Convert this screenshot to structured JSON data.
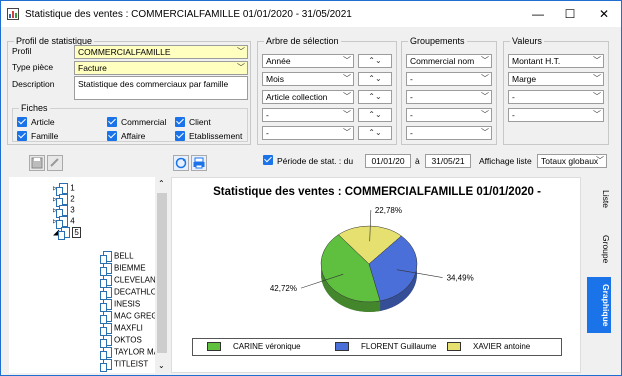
{
  "window": {
    "title": "Statistique des ventes : COMMERCIALFAMILLE 01/01/2020 - 31/05/2021",
    "minimize": "—",
    "maximize": "☐",
    "close": "✕"
  },
  "profil": {
    "group_title": "Profil de statistique",
    "profil_label": "Profil",
    "profil_value": "COMMERCIALFAMILLE",
    "type_label": "Type pièce",
    "type_value": "Facture",
    "desc_label": "Description",
    "desc_value": "Statistique des commerciaux par famille",
    "fiches_title": "Fiches",
    "fiches": [
      "Article",
      "Commercial",
      "Client",
      "Famille",
      "Affaire",
      "Etablissement"
    ]
  },
  "arbre": {
    "group_title": "Arbre de sélection",
    "rows": [
      "Année",
      "Mois",
      "Article collection",
      "-",
      "-"
    ]
  },
  "groupements": {
    "group_title": "Groupements",
    "rows": [
      "Commercial nom",
      "-",
      "-",
      "-",
      "-"
    ]
  },
  "valeurs": {
    "group_title": "Valeurs",
    "rows": [
      "Montant H.T.",
      "Marge",
      "-",
      "-"
    ]
  },
  "period": {
    "label": "Période de stat. : du",
    "from": "01/01/20",
    "to_label": "à",
    "to": "31/05/21",
    "affichage_label": "Affichage liste",
    "affichage_value": "Totaux globaux"
  },
  "tree": {
    "nodes": [
      "1",
      "2",
      "3",
      "4",
      "5"
    ],
    "children": [
      "BELL",
      "BIEMME",
      "CLEVELAND",
      "DECATHLON",
      "INESIS",
      "MAC GREGOR",
      "MAXFLI",
      "OKTOS",
      "TAYLOR MADE",
      "TITLEIST"
    ]
  },
  "chart_data": {
    "type": "pie",
    "title": "Statistique des ventes : COMMERCIALFAMILLE 01/01/2020 -",
    "categories": [
      "CARINE véronique",
      "FLORENT Guillaume",
      "XAVIER antoine"
    ],
    "values": [
      42.72,
      34.49,
      22.78
    ],
    "labels": [
      "42,72%",
      "34,49%",
      "22,78%"
    ],
    "colors": [
      "#5fbf3f",
      "#4a6fd8",
      "#e6e070"
    ],
    "legend": "bottom"
  },
  "tabs": [
    "Liste",
    "Groupe",
    "Graphique"
  ],
  "icons": [
    "save-icon",
    "undo-icon",
    "refresh-icon",
    "print-icon"
  ]
}
